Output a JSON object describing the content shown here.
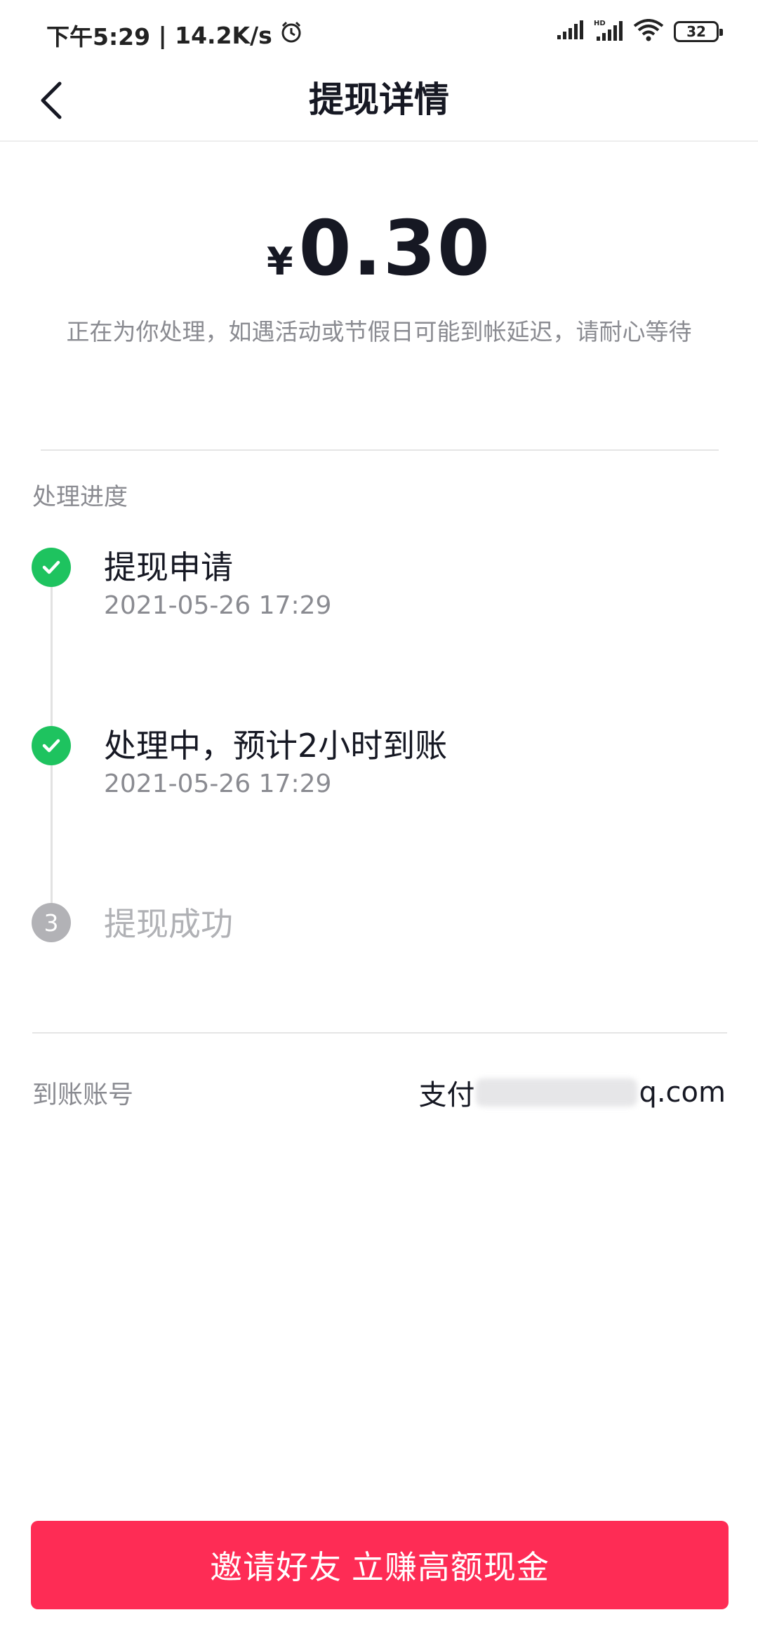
{
  "status_bar": {
    "time": "下午5:29",
    "network_speed": "14.2K/s",
    "battery": "32",
    "icons": [
      "alarm-icon",
      "signal-icon",
      "hd-signal-icon",
      "wifi-icon",
      "battery-icon"
    ]
  },
  "header": {
    "title": "提现详情",
    "back_icon": "chevron-left-icon"
  },
  "amount": {
    "currency": "¥",
    "value": "0.30"
  },
  "notice": "正在为你处理，如遇活动或节假日可能到帐延迟，请耐心等待",
  "progress": {
    "label": "处理进度",
    "steps": [
      {
        "title": "提现申请",
        "time": "2021-05-26 17:29",
        "status": "done"
      },
      {
        "title": "处理中，预计2小时到账",
        "time": "2021-05-26 17:29",
        "status": "done"
      },
      {
        "number": "3",
        "title": "提现成功",
        "status": "pending"
      }
    ]
  },
  "account": {
    "label": "到账账号",
    "prefix": "支付",
    "suffix": "q.com"
  },
  "cta": {
    "label": "邀请好友 立赚高额现金",
    "color": "#fe2c55"
  },
  "colors": {
    "success": "#1ec35f",
    "pending": "#b2b2b6",
    "muted_text": "#8a8b91"
  }
}
